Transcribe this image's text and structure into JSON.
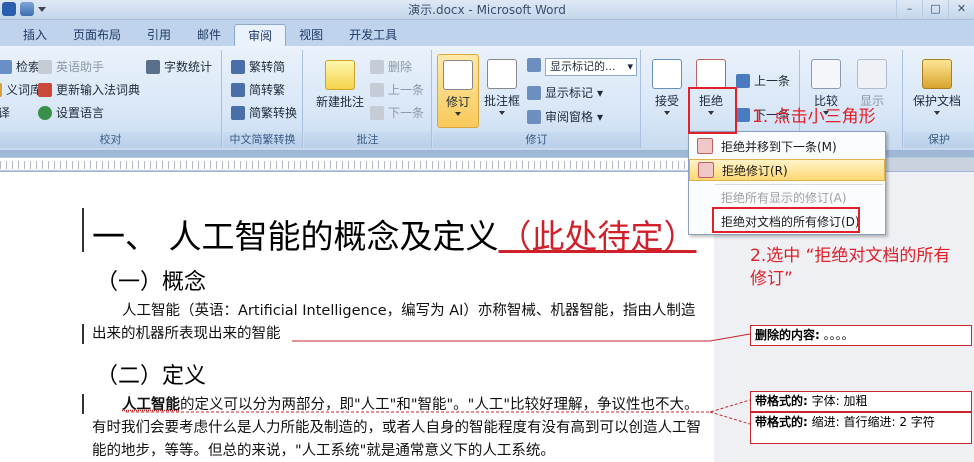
{
  "window": {
    "title": "演示.docx - Microsoft Word",
    "buttons": {
      "minimize": "–",
      "maximize": "□",
      "close": "✕"
    }
  },
  "tabs": [
    "插入",
    "页面布局",
    "引用",
    "邮件",
    "审阅",
    "视图",
    "开发工具"
  ],
  "active_tab": "审阅",
  "ribbon": {
    "proofing": {
      "label": "校对",
      "items": [
        "检索",
        "英语助手",
        "字数统计",
        "义词库",
        "更新输入法词典",
        "译",
        "设置语言"
      ]
    },
    "chinese_conversion": {
      "label": "中文简繁转换",
      "items": [
        "繁转简",
        "简转繁",
        "简繁转换"
      ]
    },
    "comments": {
      "label": "批注",
      "new_comment": "新建批注",
      "delete": "删除",
      "previous": "上一条",
      "next": "下一条"
    },
    "tracking": {
      "label": "修订",
      "track_changes": "修订",
      "balloons": "批注框",
      "display_select": "显示标记的...",
      "show_markup": "显示标记",
      "reviewing_pane": "审阅窗格"
    },
    "changes": {
      "accept": "接受",
      "reject": "拒绝",
      "previous": "上一条",
      "next": "下一条"
    },
    "compare": {
      "compare": "比较",
      "show_source": "显示"
    },
    "protect": {
      "label": "保护",
      "protect_document": "保护文档"
    }
  },
  "reject_menu": {
    "items": [
      {
        "label": "拒绝并移到下一条(M)",
        "enabled": true
      },
      {
        "label": "拒绝修订(R)",
        "enabled": true,
        "highlighted": true
      },
      {
        "label": "拒绝所有显示的修订(A)",
        "enabled": false
      },
      {
        "label": "拒绝对文档的所有修订(D)",
        "enabled": true
      }
    ]
  },
  "document": {
    "heading1_main": "一、  人工智能的概念及定义",
    "heading1_insert": "（此处待定）",
    "heading2_concept": "（一）概念",
    "para1": "人工智能（英语：Artificial Intelligence，编写为 AI）亦称智械、机器智能，指由人制造出来的机器所表现出来的智能",
    "heading2_definition": "（二）定义",
    "para2_bold": "人工智能",
    "para2_rest": "的定义可以分为两部分，即\"人工\"和\"智能\"。\"人工\"比较好理解，争议性也不大。有时我们会要考虑什么是人力所能及制造的，或者人自身的智能程度有没有高到可以创造人工智能的地步，等等。但总的来说，\"人工系统\"就是通常意义下的人工系统。"
  },
  "balloons": [
    {
      "label": "删除的内容:",
      "text": "。。。。"
    },
    {
      "label": "带格式的:",
      "text": "字体: 加粗"
    },
    {
      "label": "带格式的:",
      "text": "缩进: 首行缩进:  2 字符"
    }
  ],
  "annotations": {
    "step1": "1. 点击小三角形",
    "step2": "2.选中 “拒绝对文档的所有修订”"
  },
  "colors": {
    "annotation": "#e0202a",
    "menu_highlight": "#ffd874",
    "ribbon_bg": "#d6e5f6"
  }
}
